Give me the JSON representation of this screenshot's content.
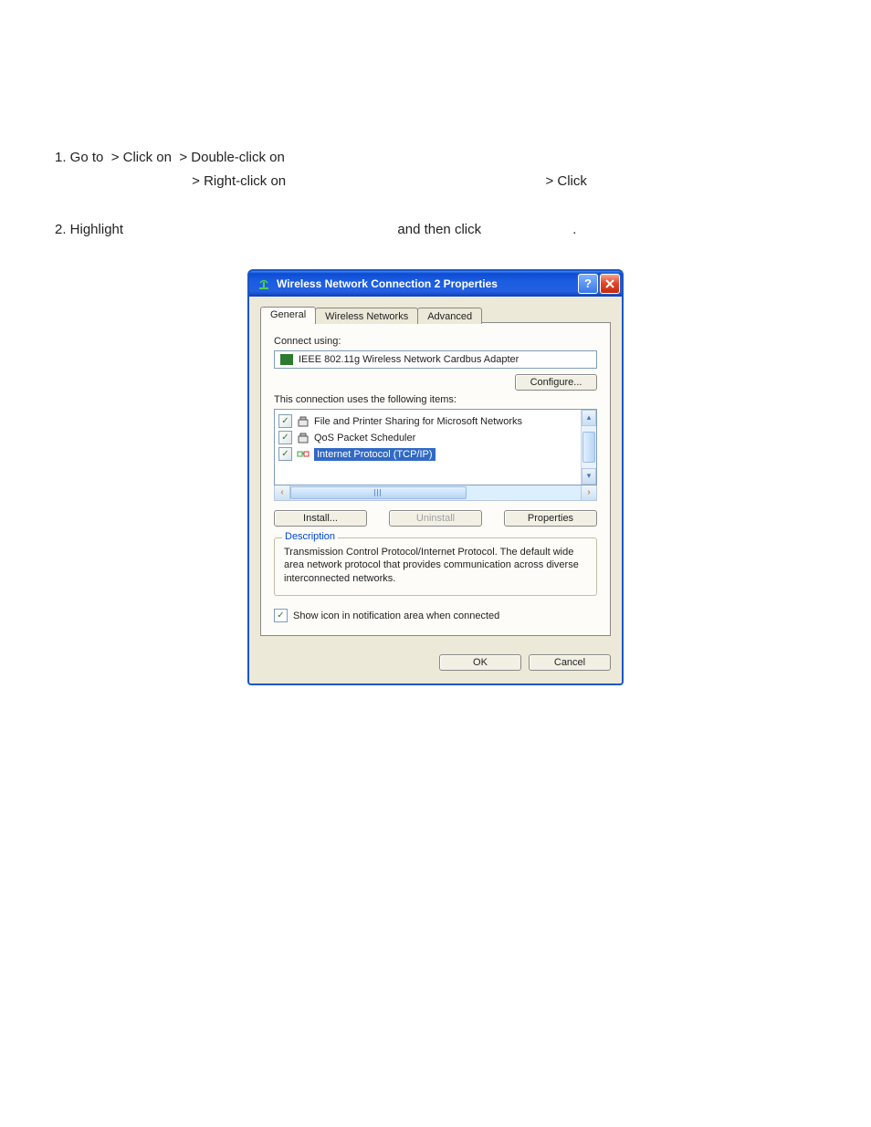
{
  "instructions": {
    "step1": {
      "a": "1. Go to ",
      "b": " > Click on ",
      "c": " > Double-click on ",
      "d": " > Right-click on ",
      "e": " > Click"
    },
    "step2": {
      "a": "2. Highlight ",
      "b": " and then click ",
      "c": "."
    }
  },
  "dialog": {
    "title": "Wireless Network Connection 2 Properties",
    "tabs": [
      "General",
      "Wireless Networks",
      "Advanced"
    ],
    "connect_using_label": "Connect using:",
    "adapter_name": "IEEE 802.11g Wireless Network Cardbus Adapter",
    "configure_btn": "Configure...",
    "items_label": "This connection uses the following items:",
    "items": [
      {
        "checked": true,
        "label": "File and Printer Sharing for Microsoft Networks",
        "selected": false
      },
      {
        "checked": true,
        "label": "QoS Packet Scheduler",
        "selected": false
      },
      {
        "checked": true,
        "label": "Internet Protocol (TCP/IP)",
        "selected": true
      }
    ],
    "install_btn": "Install...",
    "uninstall_btn": "Uninstall",
    "properties_btn": "Properties",
    "description_title": "Description",
    "description_text": "Transmission Control Protocol/Internet Protocol. The default wide area network protocol that provides communication across diverse interconnected networks.",
    "show_icon_checked": true,
    "show_icon_label": "Show icon in notification area when connected",
    "ok_btn": "OK",
    "cancel_btn": "Cancel"
  }
}
